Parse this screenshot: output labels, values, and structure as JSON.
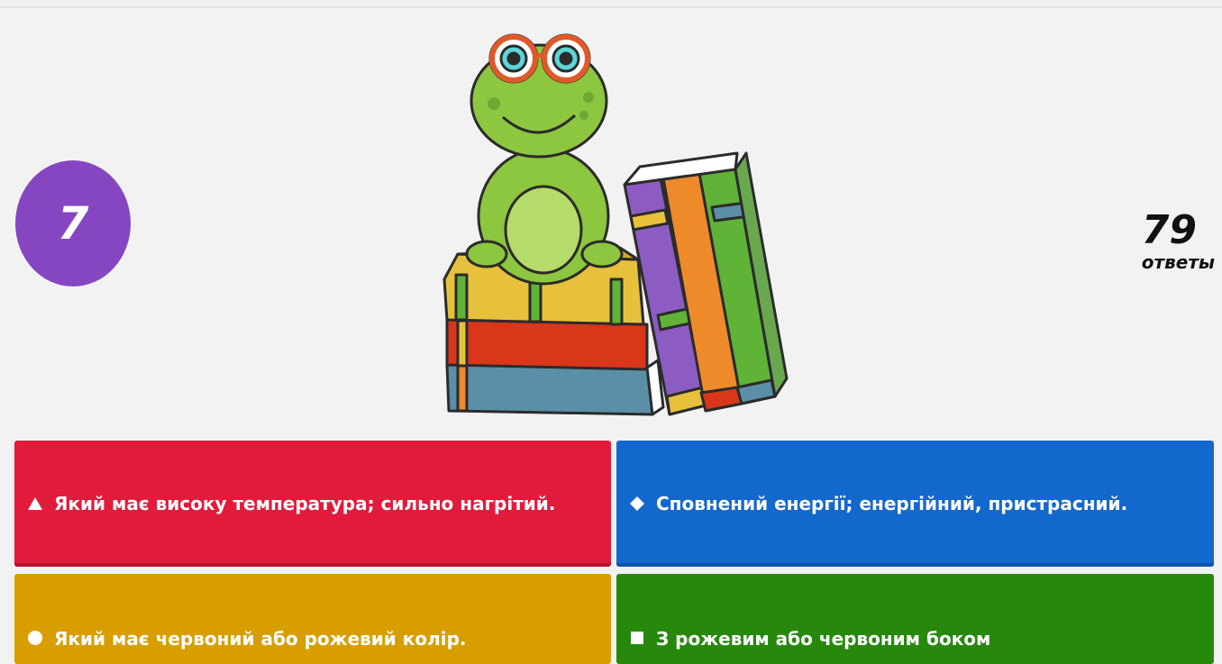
{
  "timer": {
    "value": "7"
  },
  "answers": {
    "count": "79",
    "label": "ответы"
  },
  "illustration": {
    "icon": "frog-on-books-illustration"
  },
  "options": [
    {
      "shape": "triangle-icon",
      "text": "Який має високу температура; сильно нагрітий.",
      "color": "#e21b3c"
    },
    {
      "shape": "diamond-icon",
      "text": "Сповнений енергії; енергійний, пристрасний.",
      "color": "#1368ce"
    },
    {
      "shape": "circle-icon",
      "text": "Який має червоний або рожевий колір.",
      "color": "#d89e00"
    },
    {
      "shape": "square-icon",
      "text": "З рожевим або червоним боком",
      "color": "#26890c"
    }
  ]
}
